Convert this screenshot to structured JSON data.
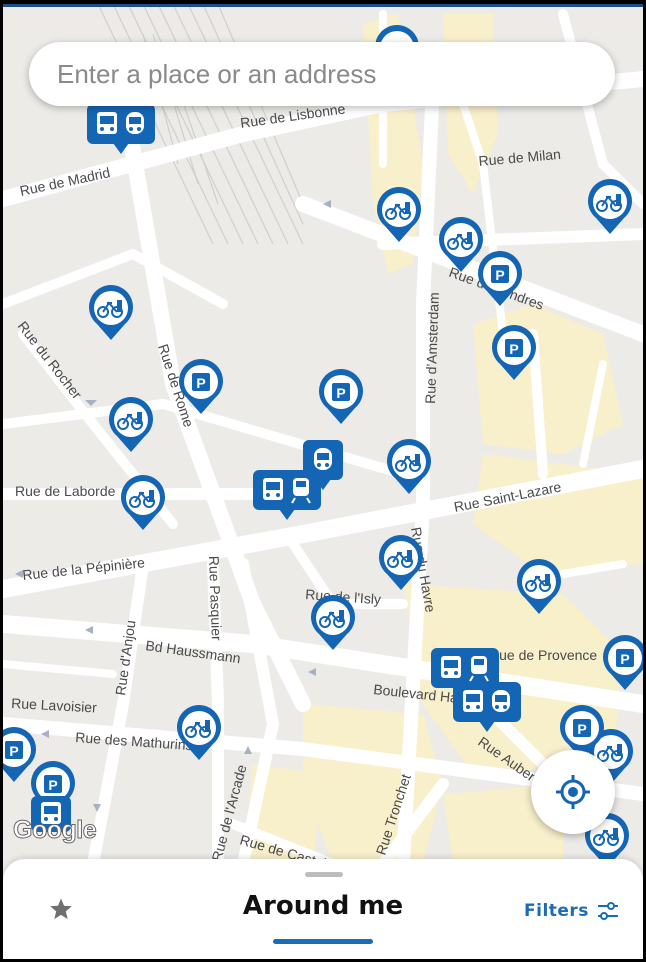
{
  "search": {
    "placeholder": "Enter a place or an address"
  },
  "map": {
    "streets": [
      "Rue de Madrid",
      "Rue de Lisbonne",
      "Rue de Milan",
      "Rue de Londres",
      "Rue d'Amsterdam",
      "Rue du Rocher",
      "Rue de Rome",
      "Rue de Laborde",
      "Rue Saint-Lazare",
      "Rue de la Pépinière",
      "Rue du Havre",
      "Rue de l'Isly",
      "Rue Pasquier",
      "Rue d'Anjou",
      "Bd Haussmann",
      "Rue de Provence",
      "Rue Lavoisier",
      "Boulevard Haussmann",
      "Rue des Mathurins",
      "Rue Auber",
      "Rue de l'Arcade",
      "Rue Tronchet",
      "Rue de Castellane"
    ],
    "attribution": "Google"
  },
  "bottom_sheet": {
    "title": "Around me",
    "filters_label": "Filters"
  },
  "colors": {
    "accent": "#1565b5",
    "road": "#ffffff",
    "block": "#ececea",
    "highlight": "#faf0c8"
  },
  "icons": [
    "bike-icon",
    "parking-icon",
    "bus-icon",
    "train-icon",
    "locate-icon",
    "star-icon",
    "filters-icon"
  ]
}
